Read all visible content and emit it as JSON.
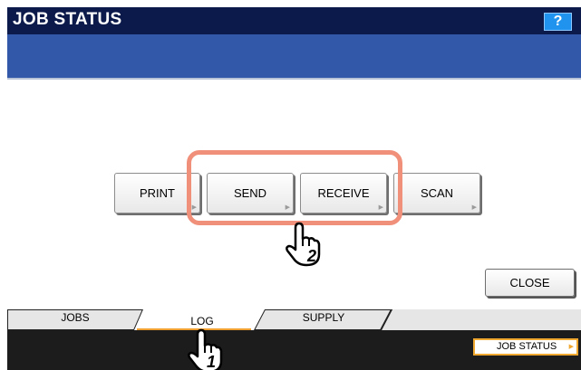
{
  "header": {
    "title": "JOB STATUS",
    "help_label": "?"
  },
  "log_categories": [
    {
      "label": "PRINT"
    },
    {
      "label": "SEND"
    },
    {
      "label": "RECEIVE"
    },
    {
      "label": "SCAN"
    }
  ],
  "close_label": "CLOSE",
  "tabs": {
    "jobs": "JOBS",
    "log": "LOG",
    "supply": "SUPPLY",
    "selected": "LOG"
  },
  "footer": {
    "job_status_label": "JOB STATUS"
  },
  "callouts": {
    "step1": "1",
    "step2": "2"
  },
  "icons": {
    "button_arrow": "triangle-right",
    "hand": "pointing-hand-icon"
  },
  "colors": {
    "title_bar": "#0b1a4a",
    "header_blue": "#3158a9",
    "help_button": "#1f93ee",
    "highlight": "#f0907a",
    "tab_underline": "#f0a030",
    "footer_bar": "#1c1c1c"
  }
}
